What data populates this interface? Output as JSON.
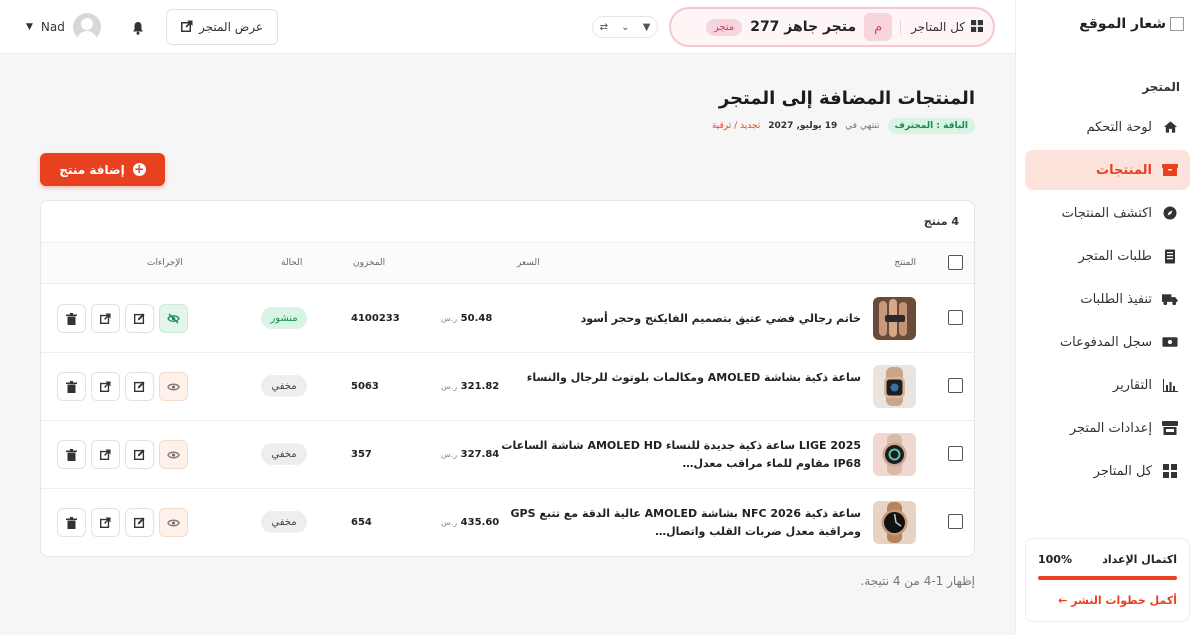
{
  "sidebar": {
    "logo_text": "شعار الموقع",
    "section_label": "المتجر",
    "items": [
      {
        "label": "لوحة التحكم",
        "icon": "home-icon"
      },
      {
        "label": "المنتجات",
        "icon": "box-icon"
      },
      {
        "label": "اكتشف المنتجات",
        "icon": "compass-icon"
      },
      {
        "label": "طلبات المتجر",
        "icon": "receipt-icon"
      },
      {
        "label": "تنفيذ الطلبات",
        "icon": "truck-icon"
      },
      {
        "label": "سجل المدفوعات",
        "icon": "money-icon"
      },
      {
        "label": "التقارير",
        "icon": "chart-icon"
      },
      {
        "label": "إعدادات المتجر",
        "icon": "store-icon"
      },
      {
        "label": "كل المتاجر",
        "icon": "grid-icon"
      }
    ],
    "setup": {
      "title": "اكتمال الإعداد",
      "percent": "100%",
      "progress": 1.0,
      "link": "أكمل خطوات النشر ←"
    }
  },
  "topbar": {
    "all_stores": "كل المتاجر",
    "store_initial": "م",
    "store_name": "متجر جاهز 277",
    "store_badge": "متجر",
    "view_store": "عرض المتجر",
    "user_name": "Nad"
  },
  "page": {
    "title": "المنتجات المضافة إلى المتجر",
    "plan_badge": "الباقة : المحترف",
    "expires_prefix": "تنتهي في",
    "expires_date": "19 يوليو, 2027",
    "renew_upgrade": "تجديد / ترقية",
    "add_button": "إضافة منتج",
    "count": "4 منتج",
    "results": "إظهار 1-4 من 4 نتيجة."
  },
  "table": {
    "headers": {
      "product": "المنتج",
      "price": "السعر",
      "stock": "المخزون",
      "status": "الحالة",
      "actions": "الإجراءات"
    },
    "currency": "ر.س",
    "rows": [
      {
        "name": "خاتم رجالي فضي عتيق بتصميم الفايكنج وحجر أسود",
        "price": "50.48",
        "stock": "4100233",
        "status": "منشور"
      },
      {
        "name": "ساعة ذكية بشاشة AMOLED ومكالمات بلوتوث للرجال والنساء",
        "price": "321.82",
        "stock": "5063",
        "status": "مخفي"
      },
      {
        "name": "LIGE 2025 ساعة ذكية جديدة للنساء AMOLED HD شاشة الساعات IP68 مقاوم للماء مراقب معدل…",
        "price": "327.84",
        "stock": "357",
        "status": "مخفي"
      },
      {
        "name": "ساعة ذكية NFC 2026 بشاشة AMOLED عالية الدقة مع تتبع GPS ومراقبة معدل ضربات القلب واتصال…",
        "price": "435.60",
        "stock": "654",
        "status": "مخفي"
      }
    ]
  },
  "colors": {
    "accent": "#e8411f",
    "published": "#1c8c52",
    "pill_border": "#f6c7cf"
  }
}
